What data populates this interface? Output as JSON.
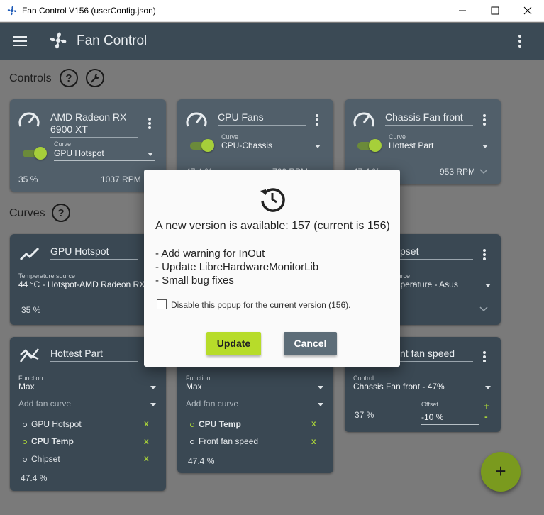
{
  "window": {
    "title": "Fan Control V156 (userConfig.json)"
  },
  "appbar": {
    "title": "Fan Control"
  },
  "sections": {
    "controls": "Controls",
    "curves": "Curves"
  },
  "controls": [
    {
      "name": "AMD Radeon RX 6900 XT",
      "curve_label": "Curve",
      "curve": "GPU Hotspot",
      "percent": "35 %",
      "rpm": "1037 RPM"
    },
    {
      "name": "CPU Fans",
      "curve_label": "Curve",
      "curve": "CPU-Chassis",
      "percent": "47.4 %",
      "rpm": "760 RPM"
    },
    {
      "name": "Chassis Fan front",
      "curve_label": "Curve",
      "curve": "Hottest Part",
      "percent": "47.4 %",
      "rpm": "953 RPM"
    }
  ],
  "curves": {
    "gpu_hotspot": {
      "name": "GPU Hotspot",
      "source_label": "Temperature source",
      "source": "44 °C - Hotspot-AMD Radeon RX 6900 XT",
      "percent": "35 %"
    },
    "chipset": {
      "name": "Chipset",
      "source_label": "Temperature source",
      "source": "Chipset Temperature - Asus"
    },
    "hottest_part": {
      "name": "Hottest Part",
      "function_label": "Function",
      "function": "Max",
      "add_placeholder": "Add fan curve",
      "items": [
        "GPU Hotspot",
        "CPU Temp",
        "Chipset"
      ],
      "percent": "47.4 %"
    },
    "cpu_chassis": {
      "function_label": "Function",
      "function": "Max",
      "add_placeholder": "Add fan curve",
      "items": [
        "CPU Temp",
        "Front fan speed"
      ],
      "percent": "47.4 %"
    },
    "front_fan_speed": {
      "name": "Front fan speed",
      "control_label": "Control",
      "control": "Chassis Fan front - 47%",
      "percent": "37 %",
      "offset_label": "Offset",
      "offset": "-10 %"
    }
  },
  "dialog": {
    "headline": "A new version is available: 157 (current is 156)",
    "notes": [
      "- Add warning for InOut",
      "- Update LibreHardwareMonitorLib",
      "- Small bug fixes"
    ],
    "checkbox_label": "Disable this popup for the current version (156).",
    "update_label": "Update",
    "cancel_label": "Cancel"
  },
  "fab_label": "+",
  "icons": {
    "remove": "x",
    "add": "+",
    "minus": "-"
  },
  "colors": {
    "accent": "#a6cf3a",
    "appbar": "#3b4a55",
    "card": "#3a4853"
  }
}
